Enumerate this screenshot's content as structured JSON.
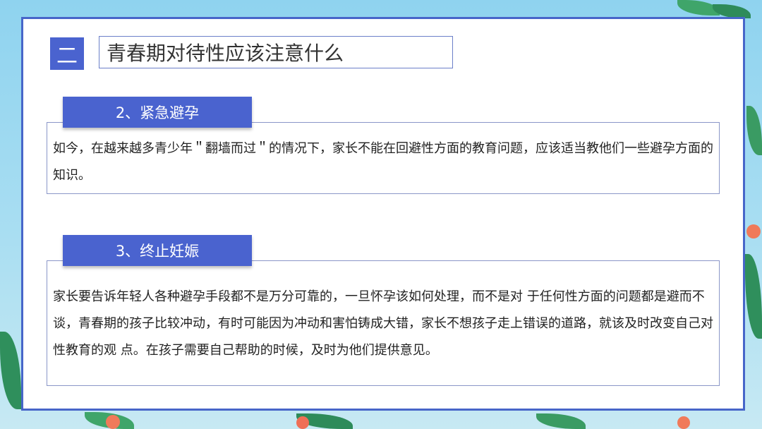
{
  "section": {
    "number": "二",
    "title": "青春期对待性应该注意什么"
  },
  "items": [
    {
      "label": "2、紧急避孕",
      "text": "如今，在越来越多青少年＂翻墙而过＂的情况下，家长不能在回避性方面的教育问题，应该适当教他们一些避孕方面的知识。"
    },
    {
      "label": "3、终止妊娠",
      "text": "家长要告诉年轻人各种避孕手段都不是万分可靠的，一旦怀孕该如何处理，而不是对 于任何性方面的问题都是避而不谈，青春期的孩子比较冲动，有时可能因为冲动和害怕铸成大错，家长不想孩子走上错误的道路，就该及时改变自己对性教育的观 点。在孩子需要自己帮助的时候，及时为他们提供意见。"
    }
  ],
  "colors": {
    "accent": "#4a63cf",
    "frame": "#4766c9",
    "background": "#a9def2"
  }
}
